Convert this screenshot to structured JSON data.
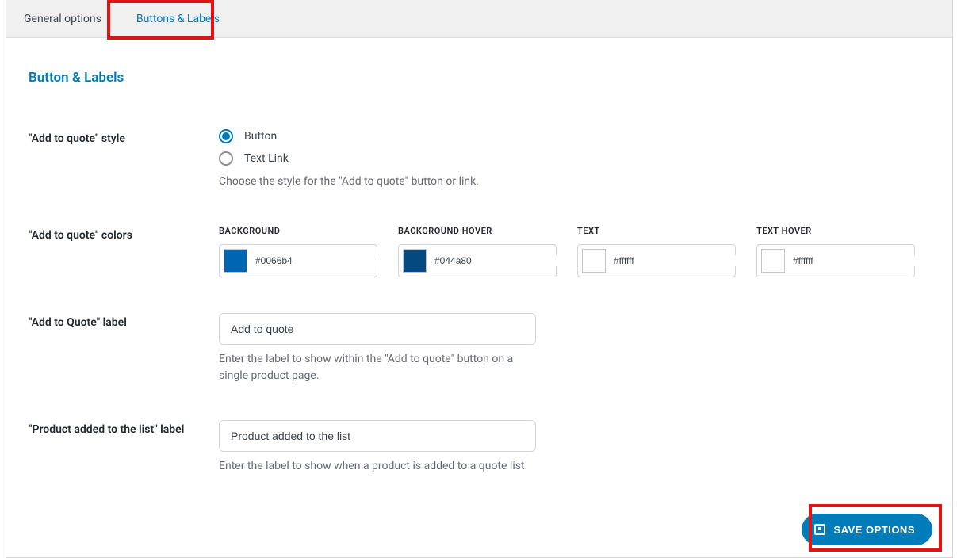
{
  "tabs": [
    {
      "label": "General options",
      "active": false
    },
    {
      "label": "Buttons & Labels",
      "active": true
    }
  ],
  "page_title": "Button & Labels",
  "fields": {
    "style": {
      "label": "\"Add to quote\" style",
      "options": [
        "Button",
        "Text Link"
      ],
      "selected": 0,
      "help": "Choose the style for the \"Add to quote\" button or link."
    },
    "colors": {
      "label": "\"Add to quote\" colors",
      "cols": [
        {
          "title": "BACKGROUND",
          "hex": "#0066b4",
          "swatch": "#0066b4"
        },
        {
          "title": "BACKGROUND HOVER",
          "hex": "#044a80",
          "swatch": "#044a80"
        },
        {
          "title": "TEXT",
          "hex": "#ffffff",
          "swatch": "#ffffff"
        },
        {
          "title": "TEXT HOVER",
          "hex": "#ffffff",
          "swatch": "#ffffff"
        }
      ]
    },
    "add_label": {
      "label": "\"Add to Quote\" label",
      "value": "Add to quote",
      "help": "Enter the label to show within the \"Add to quote\" button on a single product page."
    },
    "product_added": {
      "label": "\"Product added to the list\" label",
      "value": "Product added to the list",
      "help": "Enter the label to show when a product is added to a quote list."
    }
  },
  "save_button": "SAVE OPTIONS"
}
